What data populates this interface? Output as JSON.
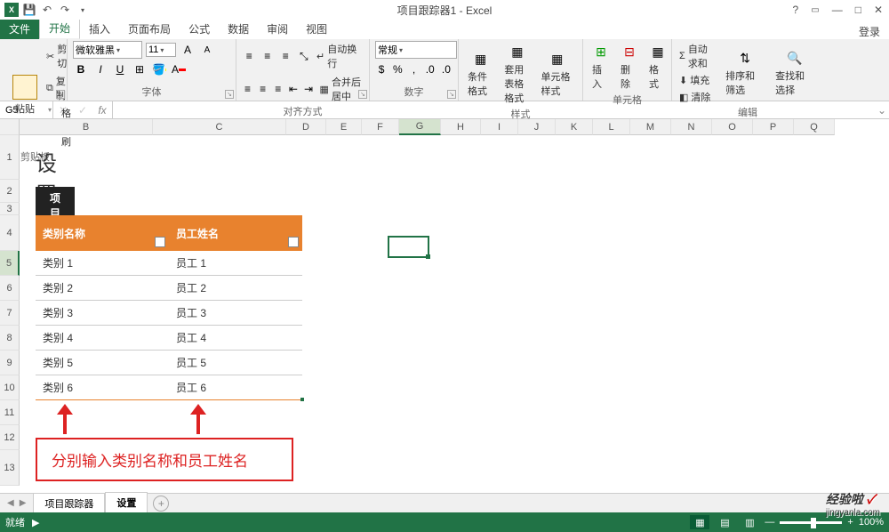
{
  "titlebar": {
    "doc_title": "项目跟踪器1 - Excel",
    "login": "登录"
  },
  "tabs": {
    "file": "文件",
    "items": [
      "开始",
      "插入",
      "页面布局",
      "公式",
      "数据",
      "审阅",
      "视图"
    ],
    "active_index": 0
  },
  "ribbon": {
    "clipboard": {
      "paste": "粘贴",
      "cut": "剪切",
      "copy": "复制",
      "format_painter": "格式刷",
      "label": "剪贴板"
    },
    "font": {
      "name": "微软雅黑",
      "size": "11",
      "bold": "B",
      "italic": "I",
      "underline": "U",
      "label": "字体"
    },
    "align": {
      "wrap": "自动换行",
      "merge": "合并后居中",
      "label": "对齐方式"
    },
    "number": {
      "format": "常规",
      "label": "数字"
    },
    "styles": {
      "cond_fmt": "条件格式",
      "table_fmt": "套用\n表格格式",
      "cell_style": "单元格样式",
      "label": "样式"
    },
    "cells": {
      "insert": "插入",
      "delete": "删除",
      "format": "格式",
      "label": "单元格"
    },
    "editing": {
      "autosum": "自动求和",
      "fill": "填充",
      "clear": "清除",
      "sort": "排序和筛选",
      "find": "查找和选择",
      "label": "编辑"
    }
  },
  "formula_bar": {
    "cell_ref": "G5",
    "fx": "fx",
    "value": ""
  },
  "col_headers": [
    "B",
    "C",
    "D",
    "E",
    "F",
    "G",
    "H",
    "I",
    "J",
    "K",
    "L",
    "M",
    "N",
    "O",
    "P",
    "Q"
  ],
  "row_headers": [
    "",
    "1",
    "2",
    "3",
    "4",
    "5",
    "6",
    "7",
    "8",
    "9",
    "10",
    "11",
    "12",
    "13"
  ],
  "active_col": "G",
  "active_row": "5",
  "sheet": {
    "title": "设置",
    "project_button": "项目",
    "headers": [
      "类别名称",
      "员工姓名"
    ],
    "rows": [
      [
        "类别 1",
        "员工 1"
      ],
      [
        "类别 2",
        "员工 2"
      ],
      [
        "类别 3",
        "员工 3"
      ],
      [
        "类别 4",
        "员工 4"
      ],
      [
        "类别 5",
        "员工 5"
      ],
      [
        "类别 6",
        "员工 6"
      ]
    ]
  },
  "annotation": {
    "text": "分别输入类别名称和员工姓名"
  },
  "sheet_tabs": {
    "items": [
      "项目跟踪器",
      "设置"
    ],
    "active_index": 1
  },
  "status": {
    "ready": "就绪",
    "zoom": "100%"
  },
  "watermark": {
    "main": "经验啦",
    "sub": "jingyanla.com",
    "check": "✓"
  }
}
